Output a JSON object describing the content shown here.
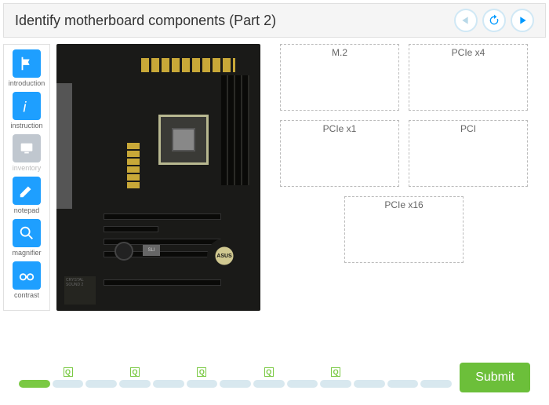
{
  "header": {
    "title": "Identify motherboard components (Part 2)"
  },
  "sidebar": {
    "items": [
      {
        "label": "introduction"
      },
      {
        "label": "instruction"
      },
      {
        "label": "inventory"
      },
      {
        "label": "notepad"
      },
      {
        "label": "magnifier"
      },
      {
        "label": "contrast"
      }
    ]
  },
  "dropzones": [
    {
      "label": "M.2"
    },
    {
      "label": "PCIe x4"
    },
    {
      "label": "PCIe x1"
    },
    {
      "label": "PCI"
    },
    {
      "label": "PCIe x16"
    }
  ],
  "footer": {
    "submit_label": "Submit",
    "q": "Q"
  },
  "mobo": {
    "brand": "ASUS",
    "sli": "SLI",
    "audio": "CRYSTAL SOUND 2"
  }
}
